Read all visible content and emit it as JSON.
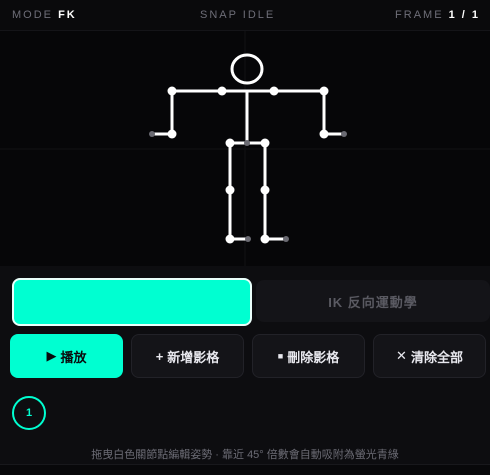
{
  "topbar": {
    "mode_label": "MODE",
    "mode_value": "FK",
    "snap_status": "SNAP IDLE",
    "frame_label": "FRAME",
    "frame_value": "1 / 1"
  },
  "mode_toggle": {
    "fk_label": "",
    "ik_label": "IK 反向運動學"
  },
  "actions": {
    "play": {
      "icon": "play-icon",
      "glyph": "▶",
      "label": "播放"
    },
    "add_frame": {
      "icon": "plus-icon",
      "glyph": "+",
      "label": "新增影格"
    },
    "delete_frame": {
      "icon": "trash-icon",
      "glyph": "■",
      "label": "刪除影格"
    },
    "clear_all": {
      "icon": "x-icon",
      "glyph": "✕",
      "label": "清除全部"
    }
  },
  "frames": [
    {
      "label": "1",
      "active": true
    }
  ],
  "hint_text": "拖曳白色關節點編輯姿勢 · 靠近 45° 倍數會自動吸附為螢光青綠",
  "colors": {
    "accent": "#00ffd1",
    "background": "#0a0a0c",
    "bone": "#ffffff"
  }
}
